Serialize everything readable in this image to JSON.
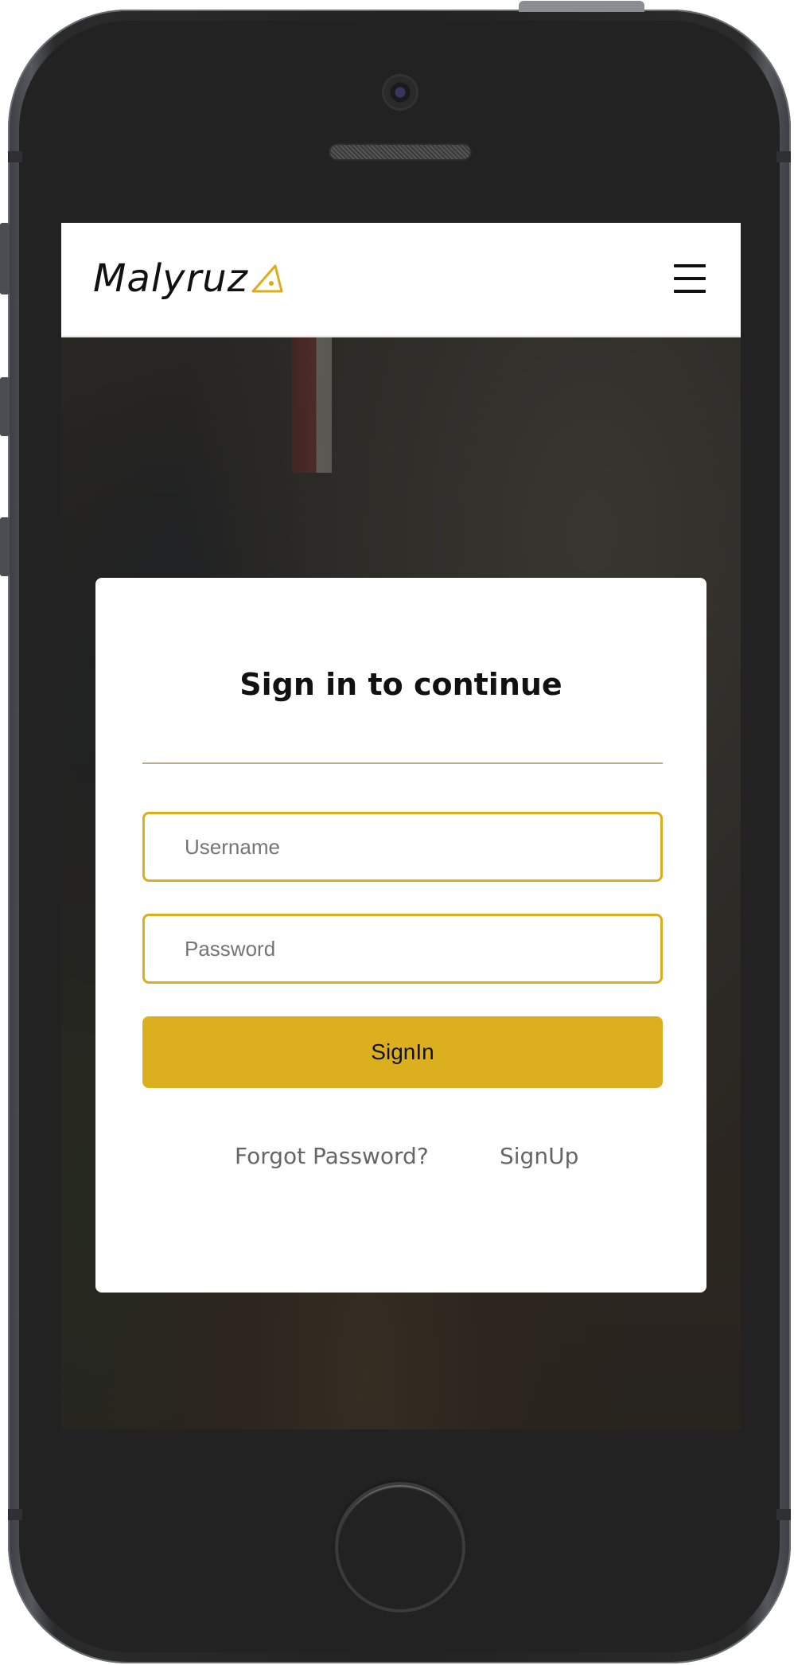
{
  "brand": {
    "name": "Malyruz",
    "accent_color": "#dcae1d"
  },
  "navbar": {
    "menu_icon": "hamburger-menu-icon"
  },
  "signin_card": {
    "title": "Sign in to continue",
    "username_placeholder": "Username",
    "password_placeholder": "Password",
    "signin_label": "SignIn",
    "forgot_password_label": "Forgot Password?",
    "signup_label": "SignUp",
    "button_color": "#dcaf1f",
    "field_border_color": "#dcae1d"
  },
  "device": {
    "frame": "smartphone",
    "home_icon": "home-button-icon"
  }
}
